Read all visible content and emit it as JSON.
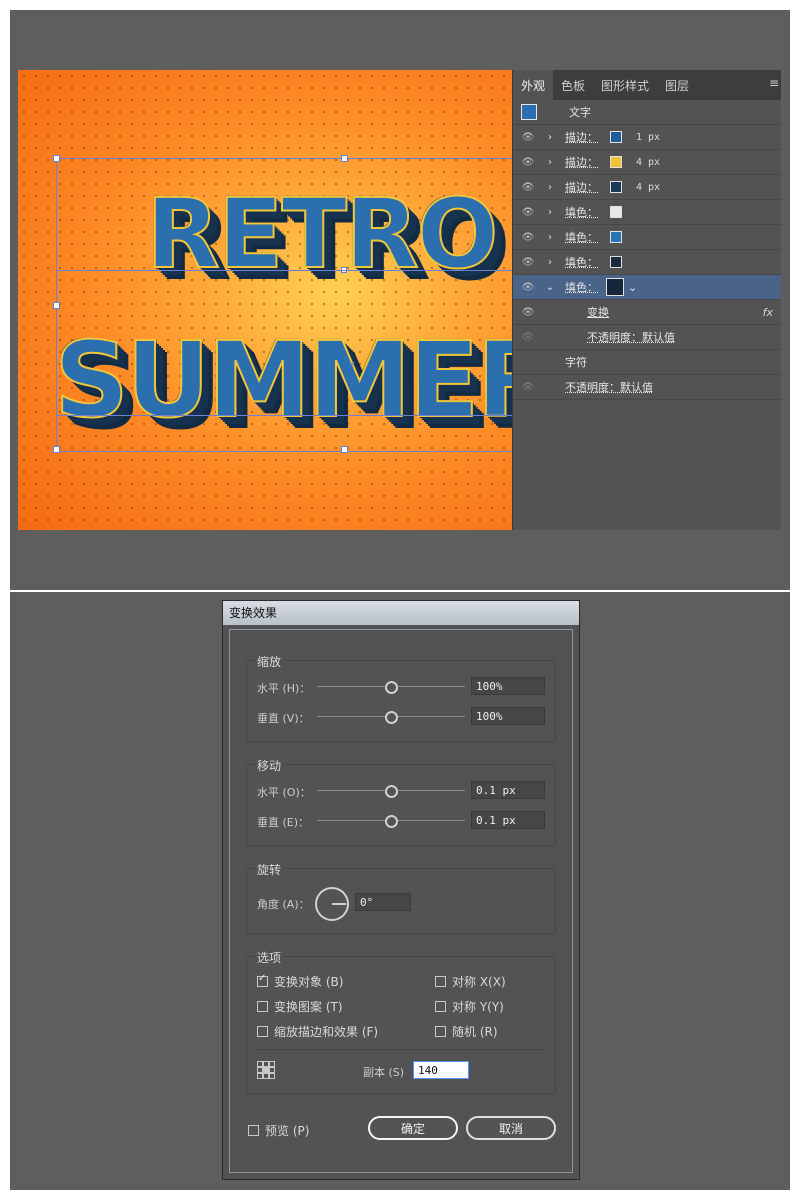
{
  "artboard": {
    "line1": "RETRO",
    "line2": "SUMMER"
  },
  "appearance_panel": {
    "tabs": [
      "外观",
      "色板",
      "图形样式",
      "图层"
    ],
    "object_type": "文字",
    "rows": [
      {
        "label": "描边：",
        "swatch": "#1f5f9e",
        "value": "1 px"
      },
      {
        "label": "描边：",
        "swatch": "#f2c23a",
        "value": "4 px"
      },
      {
        "label": "描边：",
        "swatch": "#1c3a5a",
        "value": "4 px"
      },
      {
        "label": "填色：",
        "swatch": "#e8e8e8",
        "value": ""
      },
      {
        "label": "填色：",
        "swatch": "#2b74b8",
        "value": ""
      },
      {
        "label": "填色：",
        "swatch": "#1a2b40",
        "value": ""
      }
    ],
    "selected_row": {
      "label": "填色：",
      "swatch": "#16273d"
    },
    "effect_label": "变换",
    "fx_label": "fx",
    "inner_opacity": "不透明度：默认值",
    "characters_label": "字符",
    "opacity": "不透明度：默认值"
  },
  "dialog": {
    "title": "变换效果",
    "scale": {
      "title": "缩放",
      "horizontal_label": "水平 (H)：",
      "horizontal_value": "100%",
      "vertical_label": "垂直 (V)：",
      "vertical_value": "100%"
    },
    "move": {
      "title": "移动",
      "horizontal_label": "水平 (O)：",
      "horizontal_value": "0.1 px",
      "vertical_label": "垂直 (E)：",
      "vertical_value": "0.1 px"
    },
    "rotate": {
      "title": "旋转",
      "angle_label": "角度 (A)：",
      "angle_value": "0°"
    },
    "options": {
      "title": "选项",
      "transform_objects": "变换对象 (B)",
      "transform_patterns": "变换图案 (T)",
      "scale_strokes": "缩放描边和效果 (F)",
      "reflect_x": "对称 X(X)",
      "reflect_y": "对称 Y(Y)",
      "random": "随机 (R)",
      "copies_label": "副本 (S)",
      "copies_value": "140"
    },
    "preview_label": "预览 (P)",
    "ok_label": "确定",
    "cancel_label": "取消"
  }
}
